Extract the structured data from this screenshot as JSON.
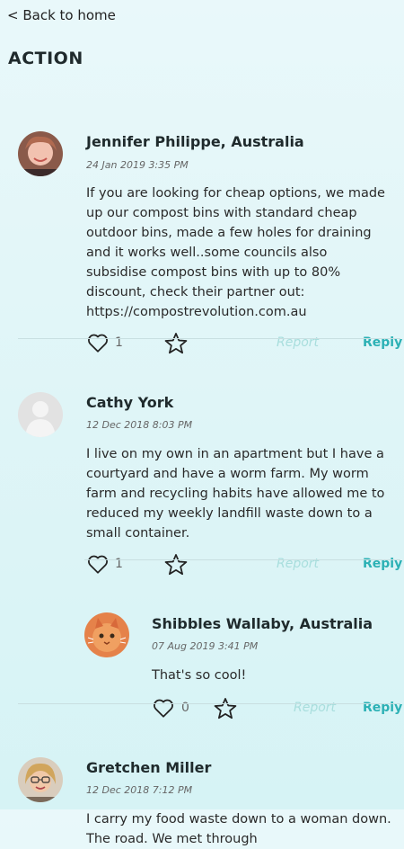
{
  "nav": {
    "back_label": "< Back to home"
  },
  "section": {
    "title": "ACTION"
  },
  "comments": [
    {
      "author": "Jennifer Philippe, Australia",
      "date": "24 Jan 2019 3:35 PM",
      "text": "If you are looking for cheap options, we made up our compost bins with standard cheap outdoor bins, made a few holes for draining and it works well..some councils also subsidise compost bins with up to 80% discount, check their partner out: https://compostrevolution.com.au",
      "likes": "1",
      "report_label": "Report",
      "reply_label": "Reply"
    },
    {
      "author": "Cathy York",
      "date": "12 Dec 2018 8:03 PM",
      "text": "I live on my own in an apartment but I have a courtyard and have a worm farm. My worm farm and recycling habits have allowed me to reduced my weekly landfill waste down to a small container.",
      "likes": "1",
      "report_label": "Report",
      "reply_label": "Reply"
    },
    {
      "author": "Shibbles Wallaby, Australia",
      "date": "07 Aug 2019 3:41 PM",
      "text": "That's so cool!",
      "likes": "0",
      "report_label": "Report",
      "reply_label": "Reply"
    },
    {
      "author": "Gretchen Miller",
      "date": "12 Dec 2018 7:12 PM",
      "text": "I carry my food waste down to a woman down. The road. We met through"
    }
  ],
  "colors": {
    "accent": "#2cb1b5",
    "report": "#a8dedd",
    "background": "#e0f6f8"
  }
}
